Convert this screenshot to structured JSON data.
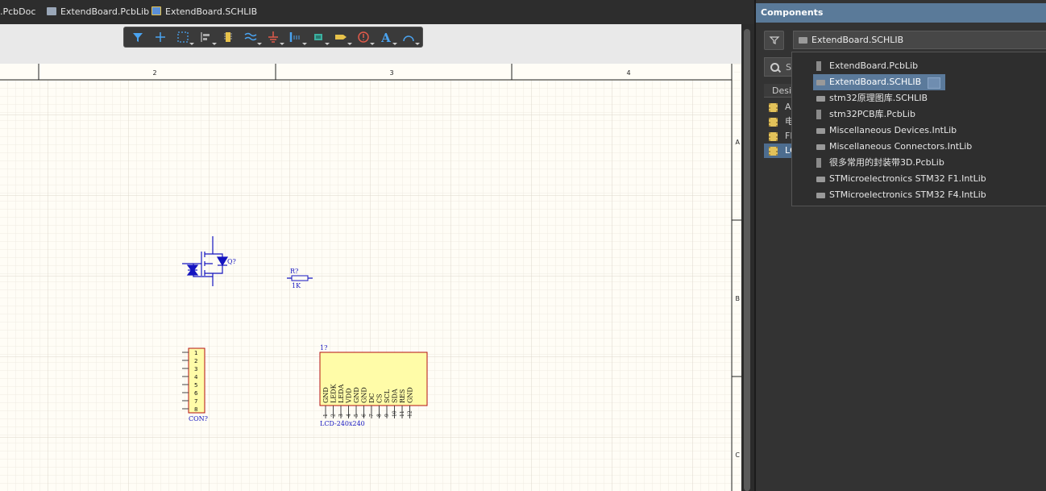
{
  "tabs": [
    {
      "label": ".PcbDoc",
      "icon": "pcb-doc-icon"
    },
    {
      "label": "ExtendBoard.PcbLib",
      "icon": "pcb-lib-icon"
    },
    {
      "label": "ExtendBoard.SCHLIB",
      "icon": "sch-lib-icon"
    }
  ],
  "toolbar": {
    "tools": [
      "filter-icon",
      "cross-icon",
      "select-area-icon",
      "align-icon",
      "component-icon",
      "wire-icon",
      "ground-icon",
      "bus-icon",
      "harness-icon",
      "port-icon",
      "sheet-symbol-icon",
      "text-icon",
      "arc-icon"
    ]
  },
  "ruler": {
    "columns": [
      "2",
      "3",
      "4"
    ],
    "rows": [
      "A",
      "B",
      "C"
    ]
  },
  "schematic": {
    "mosfet_designator": "Q?",
    "resistor_designator": "R?",
    "resistor_value": "1K",
    "connector_designator": "CON?",
    "connector_pins": [
      "1",
      "2",
      "3",
      "4",
      "5",
      "6",
      "7",
      "8"
    ],
    "lcd_designator": "1?",
    "lcd_name": "LCD-240x240",
    "lcd_pins": [
      "GND",
      "LEDK",
      "LEDA",
      "VDD",
      "GND",
      "GND",
      "DC",
      "CS",
      "SCL",
      "SDA",
      "RES",
      "GND"
    ],
    "lcd_pin_numbers": [
      "1",
      "2",
      "3",
      "4",
      "5",
      "6",
      "7",
      "8",
      "9",
      "10",
      "11",
      "12"
    ]
  },
  "panel": {
    "title": "Components",
    "selected_library": "ExtendBoard.SCHLIB",
    "search_placeholder": "Se",
    "column_header": "Desig",
    "component_rows": [
      "AC",
      "电",
      "FF",
      "LC"
    ]
  },
  "dropdown": {
    "items": [
      {
        "label": "ExtendBoard.PcbLib",
        "type": "pcblib"
      },
      {
        "label": "ExtendBoard.SCHLIB",
        "type": "schlib",
        "selected": true
      },
      {
        "label": "stm32原理图库.SCHLIB",
        "type": "schlib"
      },
      {
        "label": "stm32PCB库.PcbLib",
        "type": "pcblib"
      },
      {
        "label": "Miscellaneous Devices.IntLib",
        "type": "intlib"
      },
      {
        "label": "Miscellaneous Connectors.IntLib",
        "type": "intlib"
      },
      {
        "label": "很多常用的封装带3D.PcbLib",
        "type": "pcblib"
      },
      {
        "label": "STMicroelectronics STM32 F1.IntLib",
        "type": "intlib"
      },
      {
        "label": "STMicroelectronics STM32 F4.IntLib",
        "type": "intlib"
      }
    ]
  }
}
